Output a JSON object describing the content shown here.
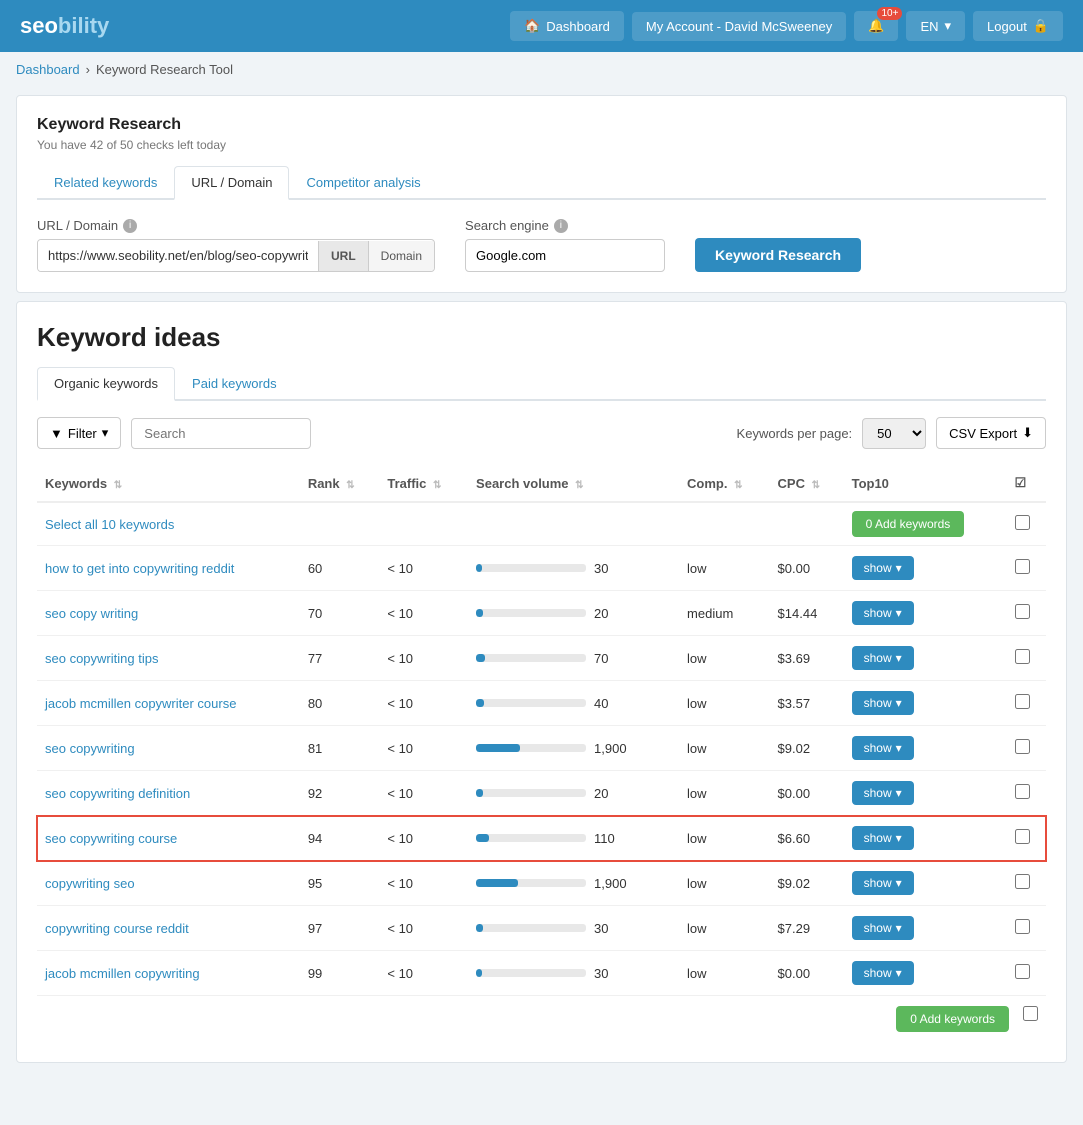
{
  "header": {
    "logo": "seobility",
    "nav": {
      "dashboard_label": "Dashboard",
      "account_label": "My Account - David McSweeney",
      "notif_count": "10+",
      "lang_label": "EN",
      "logout_label": "Logout"
    }
  },
  "breadcrumb": {
    "home": "Dashboard",
    "sep": "▶",
    "current": "Keyword Research Tool"
  },
  "kw_research": {
    "title": "Keyword Research",
    "subtitle": "You have 42 of 50 checks left today",
    "tabs": [
      {
        "label": "Related keywords",
        "active": false
      },
      {
        "label": "URL / Domain",
        "active": true
      },
      {
        "label": "Competitor analysis",
        "active": false
      }
    ],
    "form": {
      "url_label": "URL / Domain",
      "url_value": "https://www.seobility.net/en/blog/seo-copywriting/",
      "url_btn": "URL",
      "domain_btn": "Domain",
      "engine_label": "Search engine",
      "engine_value": "Google.com",
      "research_btn": "Keyword Research"
    }
  },
  "keyword_ideas": {
    "title": "Keyword ideas",
    "sub_tabs": [
      {
        "label": "Organic keywords",
        "active": true
      },
      {
        "label": "Paid keywords",
        "active": false
      }
    ],
    "filter": {
      "filter_btn": "Filter",
      "search_placeholder": "Search",
      "per_page_label": "Keywords per page:",
      "per_page_value": "50",
      "csv_btn": "CSV Export"
    },
    "table": {
      "columns": [
        "Keywords",
        "Rank",
        "Traffic",
        "Search volume",
        "Comp.",
        "CPC",
        "Top10",
        ""
      ],
      "select_all": "Select all 10 keywords",
      "add_keywords_btn": "0 Add keywords",
      "rows": [
        {
          "keyword": "how to get into copywriting reddit",
          "rank": 60,
          "traffic": "< 10",
          "sv": 30,
          "sv_pct": 5,
          "comp": "low",
          "cpc": "$0.00",
          "highlighted": false
        },
        {
          "keyword": "seo copy writing",
          "rank": 70,
          "traffic": "< 10",
          "sv": 20,
          "sv_pct": 6,
          "comp": "medium",
          "cpc": "$14.44",
          "highlighted": false
        },
        {
          "keyword": "seo copywriting tips",
          "rank": 77,
          "traffic": "< 10",
          "sv": 70,
          "sv_pct": 8,
          "comp": "low",
          "cpc": "$3.69",
          "highlighted": false
        },
        {
          "keyword": "jacob mcmillen copywriter course",
          "rank": 80,
          "traffic": "< 10",
          "sv": 40,
          "sv_pct": 7,
          "comp": "low",
          "cpc": "$3.57",
          "highlighted": false
        },
        {
          "keyword": "seo copywriting",
          "rank": 81,
          "traffic": "< 10",
          "sv": 1900,
          "sv_pct": 40,
          "comp": "low",
          "cpc": "$9.02",
          "highlighted": false
        },
        {
          "keyword": "seo copywriting definition",
          "rank": 92,
          "traffic": "< 10",
          "sv": 20,
          "sv_pct": 6,
          "comp": "low",
          "cpc": "$0.00",
          "highlighted": false
        },
        {
          "keyword": "seo copywriting course",
          "rank": 94,
          "traffic": "< 10",
          "sv": 110,
          "sv_pct": 12,
          "comp": "low",
          "cpc": "$6.60",
          "highlighted": true
        },
        {
          "keyword": "copywriting seo",
          "rank": 95,
          "traffic": "< 10",
          "sv": 1900,
          "sv_pct": 38,
          "comp": "low",
          "cpc": "$9.02",
          "highlighted": false
        },
        {
          "keyword": "copywriting course reddit",
          "rank": 97,
          "traffic": "< 10",
          "sv": 30,
          "sv_pct": 6,
          "comp": "low",
          "cpc": "$7.29",
          "highlighted": false
        },
        {
          "keyword": "jacob mcmillen copywriting",
          "rank": 99,
          "traffic": "< 10",
          "sv": 30,
          "sv_pct": 5,
          "comp": "low",
          "cpc": "$0.00",
          "highlighted": false
        }
      ],
      "bottom_add_btn": "0 Add keywords"
    }
  }
}
